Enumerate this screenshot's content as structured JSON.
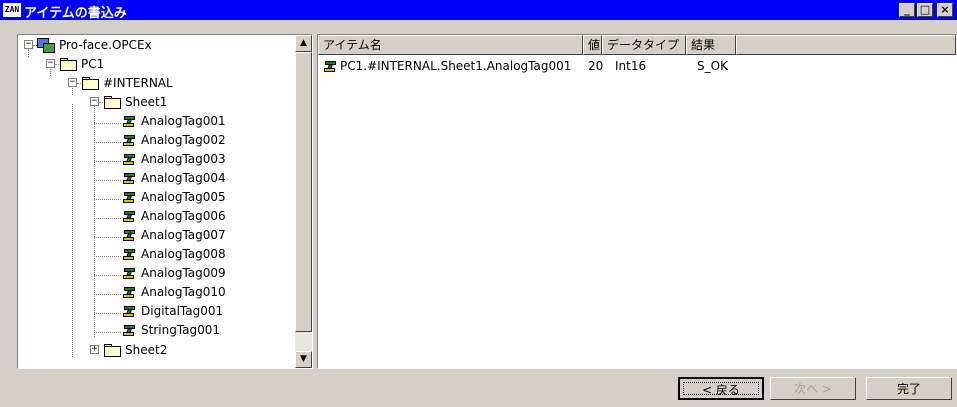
{
  "window": {
    "title": "アイテムの書込み",
    "icon_text": "ZAN",
    "controls": {
      "minimize": "_",
      "maximize": "□",
      "close": "×"
    }
  },
  "tree": {
    "nodes": [
      {
        "label": "Pro-face.OPCEx",
        "icon": "opc-server-icon",
        "expander": "−"
      },
      {
        "label": "PC1",
        "icon": "folder-icon",
        "expander": "−"
      },
      {
        "label": "#INTERNAL",
        "icon": "folder-icon",
        "expander": "−"
      },
      {
        "label": "Sheet1",
        "icon": "folder-icon",
        "expander": "−"
      },
      {
        "label": "AnalogTag001",
        "icon": "tag-icon"
      },
      {
        "label": "AnalogTag002",
        "icon": "tag-icon"
      },
      {
        "label": "AnalogTag003",
        "icon": "tag-icon"
      },
      {
        "label": "AnalogTag004",
        "icon": "tag-icon"
      },
      {
        "label": "AnalogTag005",
        "icon": "tag-icon"
      },
      {
        "label": "AnalogTag006",
        "icon": "tag-icon"
      },
      {
        "label": "AnalogTag007",
        "icon": "tag-icon"
      },
      {
        "label": "AnalogTag008",
        "icon": "tag-icon"
      },
      {
        "label": "AnalogTag009",
        "icon": "tag-icon"
      },
      {
        "label": "AnalogTag010",
        "icon": "tag-icon"
      },
      {
        "label": "DigitalTag001",
        "icon": "tag-icon"
      },
      {
        "label": "StringTag001",
        "icon": "tag-icon"
      },
      {
        "label": "Sheet2",
        "icon": "folder-icon",
        "expander": "+"
      }
    ],
    "scroll_up": "▲",
    "scroll_down": "▼"
  },
  "list": {
    "headers": {
      "name": "アイテム名",
      "value": "値",
      "type": "データタイプ",
      "result": "結果"
    },
    "rows": [
      {
        "name": "PC1.#INTERNAL.Sheet1.AnalogTag001",
        "value": "20",
        "type": "Int16",
        "result": "S_OK"
      }
    ]
  },
  "buttons": {
    "back": "< 戻る",
    "next": "次へ >",
    "finish": "完了"
  },
  "colors": {
    "titlebar": "#0000ff",
    "face": "#d4d0c8"
  }
}
